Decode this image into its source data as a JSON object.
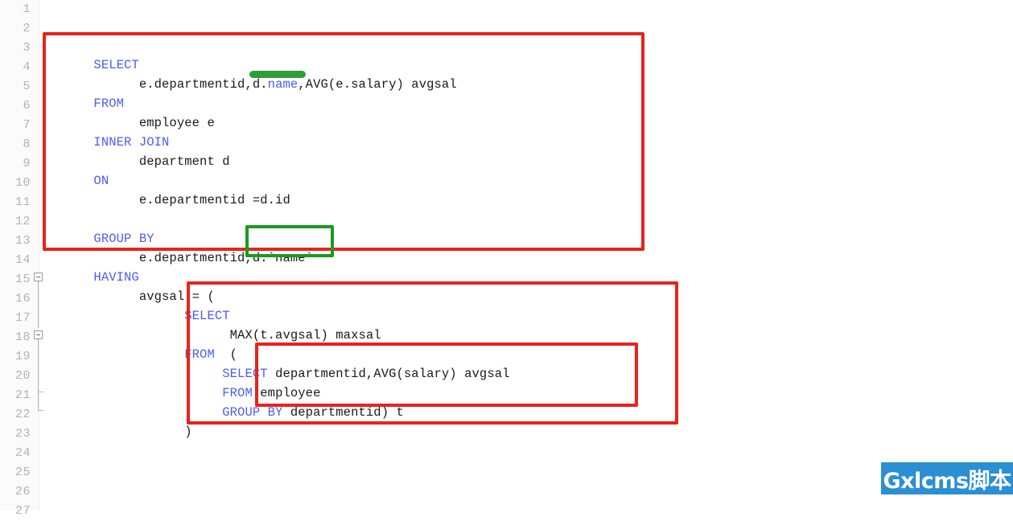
{
  "editor": {
    "background_color": "#ffffff",
    "gutter_color": "#fbfbfb",
    "keyword_color": "#4a5df5",
    "text_color": "#1a1a1a",
    "line_number_color": "#b2b2b2",
    "highlight_red": "#e8231c",
    "highlight_green": "#199b1e",
    "underline_green": "#2f9e36"
  },
  "line_numbers": [
    "1",
    "2",
    "3",
    "4",
    "5",
    "6",
    "7",
    "8",
    "9",
    "10",
    "11",
    "12",
    "13",
    "14",
    "15",
    "16",
    "17",
    "18",
    "19",
    "20",
    "21",
    "22",
    "23",
    "24",
    "25",
    "26",
    "27"
  ],
  "code": {
    "lines": [
      {
        "number": "1",
        "indent": 0,
        "tokens": []
      },
      {
        "number": "2",
        "indent": 0,
        "tokens": []
      },
      {
        "number": "3",
        "indent": 0,
        "tokens": [
          {
            "t": "SELECT",
            "k": true
          }
        ]
      },
      {
        "number": "4",
        "indent": 0,
        "tokens": [
          {
            "t": "      e.departmentid,d.",
            "k": false
          },
          {
            "t": "name",
            "k": true
          },
          {
            "t": ",AVG(e.salary) avgsal",
            "k": false
          }
        ]
      },
      {
        "number": "5",
        "indent": 0,
        "tokens": [
          {
            "t": "FROM",
            "k": true
          }
        ]
      },
      {
        "number": "6",
        "indent": 0,
        "tokens": [
          {
            "t": "      employee e",
            "k": false
          }
        ]
      },
      {
        "number": "7",
        "indent": 0,
        "tokens": [
          {
            "t": "INNER JOIN",
            "k": true
          }
        ]
      },
      {
        "number": "8",
        "indent": 0,
        "tokens": [
          {
            "t": "      department d",
            "k": false
          }
        ]
      },
      {
        "number": "9",
        "indent": 0,
        "tokens": [
          {
            "t": "ON",
            "k": true
          }
        ]
      },
      {
        "number": "10",
        "indent": 0,
        "tokens": [
          {
            "t": "      e.departmentid =d.id",
            "k": false
          }
        ]
      },
      {
        "number": "11",
        "indent": 0,
        "tokens": []
      },
      {
        "number": "12",
        "indent": 0,
        "tokens": [
          {
            "t": "GROUP BY",
            "k": true
          }
        ]
      },
      {
        "number": "13",
        "indent": 0,
        "tokens": [
          {
            "t": "      e.departmentid,d.`name`",
            "k": false
          }
        ]
      },
      {
        "number": "14",
        "indent": 0,
        "tokens": [
          {
            "t": "HAVING",
            "k": true
          }
        ]
      },
      {
        "number": "15",
        "indent": 0,
        "tokens": [
          {
            "t": "      avgsal = (",
            "k": false
          }
        ]
      },
      {
        "number": "16",
        "indent": 0,
        "tokens": [
          {
            "t": "            ",
            "k": false
          },
          {
            "t": "SELECT",
            "k": true
          }
        ]
      },
      {
        "number": "17",
        "indent": 0,
        "tokens": [
          {
            "t": "                  MAX(t.avgsal) maxsal",
            "k": false
          }
        ]
      },
      {
        "number": "18",
        "indent": 0,
        "tokens": [
          {
            "t": "            ",
            "k": false
          },
          {
            "t": "FROM",
            "k": true
          },
          {
            "t": "  (",
            "k": false
          }
        ]
      },
      {
        "number": "19",
        "indent": 0,
        "tokens": [
          {
            "t": "                 ",
            "k": false
          },
          {
            "t": "SELECT",
            "k": true
          },
          {
            "t": " departmentid,AVG(salary) avgsal",
            "k": false
          }
        ]
      },
      {
        "number": "20",
        "indent": 0,
        "tokens": [
          {
            "t": "                 ",
            "k": false
          },
          {
            "t": "FROM",
            "k": true
          },
          {
            "t": " employee",
            "k": false
          }
        ]
      },
      {
        "number": "21",
        "indent": 0,
        "tokens": [
          {
            "t": "                 ",
            "k": false
          },
          {
            "t": "GROUP BY",
            "k": true
          },
          {
            "t": " departmentid) t",
            "k": false
          }
        ]
      },
      {
        "number": "22",
        "indent": 0,
        "tokens": [
          {
            "t": "            )",
            "k": false
          }
        ]
      },
      {
        "number": "23",
        "indent": 0,
        "tokens": []
      },
      {
        "number": "24",
        "indent": 0,
        "tokens": []
      },
      {
        "number": "25",
        "indent": 0,
        "tokens": []
      },
      {
        "number": "26",
        "indent": 0,
        "tokens": []
      },
      {
        "number": "27",
        "indent": 0,
        "tokens": []
      }
    ],
    "full_text": "SELECT\n      e.departmentid,d.name,AVG(e.salary) avgsal\nFROM\n      employee e\nINNER JOIN\n      department d\nON\n      e.departmentid =d.id\n\nGROUP BY\n      e.departmentid,d.`name`\nHAVING\n      avgsal = (\n            SELECT\n                  MAX(t.avgsal) maxsal\n            FROM  (\n                 SELECT departmentid,AVG(salary) avgsal\n                 FROM employee\n                 GROUP BY departmentid) t\n            )"
  },
  "fold_markers": [
    {
      "line": "15",
      "type": "collapsible-minus"
    },
    {
      "line": "18",
      "type": "collapsible-minus"
    }
  ],
  "annotations": {
    "red_boxes": [
      {
        "id": "outer-query-box",
        "lines": "3-13",
        "label": "outer query highlight"
      },
      {
        "id": "subquery-box",
        "lines": "16-22",
        "label": "subquery highlight"
      },
      {
        "id": "inner-subquery-box",
        "lines": "19-21",
        "label": "inner derived table highlight"
      }
    ],
    "green_boxes": [
      {
        "id": "group-by-name-box",
        "line": "13",
        "text": "d.`name`",
        "label": "group by column highlight"
      }
    ],
    "green_underlines": [
      {
        "id": "select-name-underline",
        "line": "4",
        "text": "d.name",
        "label": "selected column underline"
      }
    ]
  },
  "watermark": {
    "text": "Gxlcms脚本",
    "background_color": "#2b8fd4",
    "text_color": "#ffffff"
  }
}
